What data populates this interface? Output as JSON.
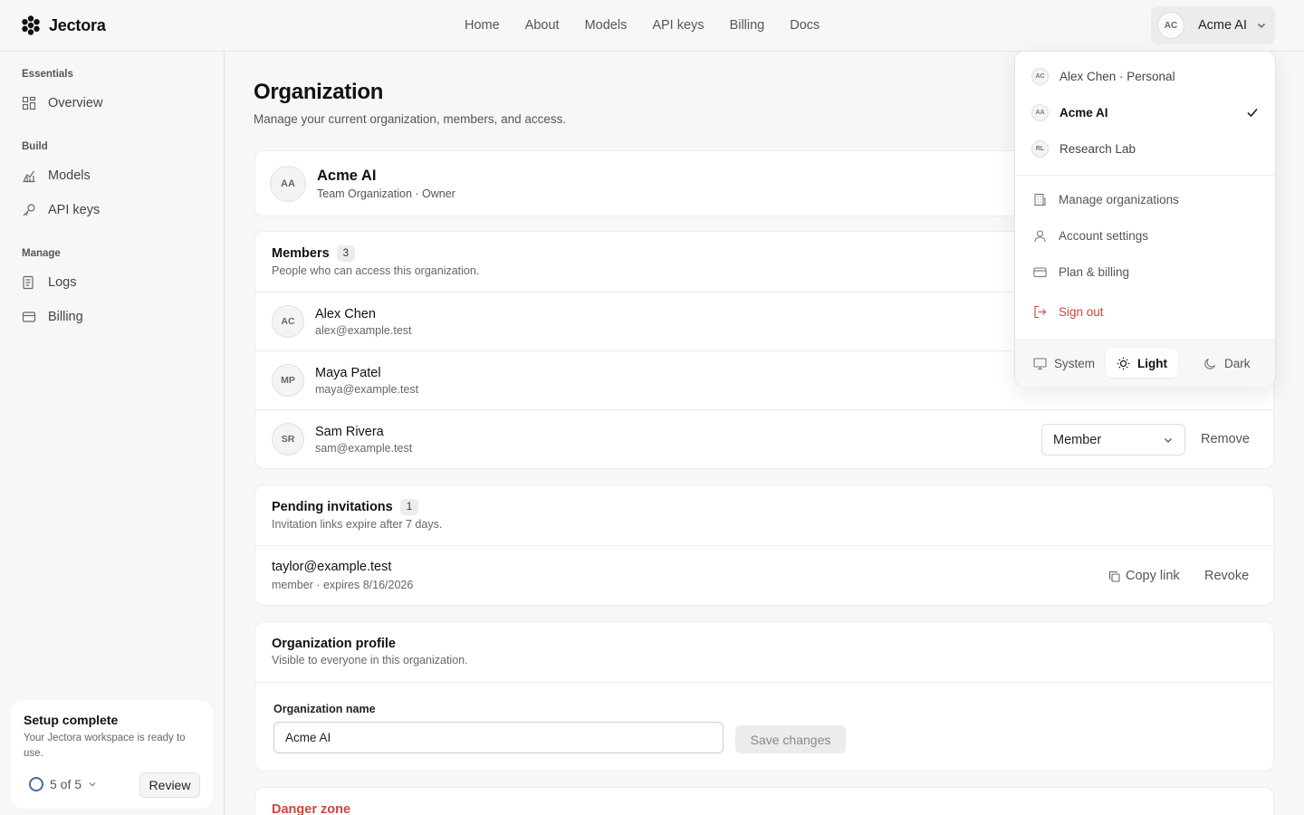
{
  "brand": {
    "name": "Jectora"
  },
  "nav": {
    "items": [
      "Home",
      "About",
      "Models",
      "API keys",
      "Billing",
      "Docs"
    ]
  },
  "account": {
    "initials": "AC",
    "label": "Acme AI"
  },
  "sidebar": {
    "groups": [
      {
        "title": "Essentials",
        "items": [
          "Overview"
        ]
      },
      {
        "title": "Build",
        "items": [
          "Models",
          "API keys"
        ]
      },
      {
        "title": "Manage",
        "items": [
          "Logs",
          "Billing"
        ]
      }
    ],
    "setup": {
      "title": "Setup complete",
      "desc": "Your Jectora workspace is ready to use.",
      "progress": "5 of 5",
      "review": "Review"
    }
  },
  "page": {
    "title": "Organization",
    "subtitle": "Manage your current organization, members, and access."
  },
  "org": {
    "initials": "AA",
    "name": "Acme AI",
    "meta": "Team Organization · Owner"
  },
  "members": {
    "title": "Members",
    "count": "3",
    "subtitle": "People who can access this organization.",
    "rows": [
      {
        "initials": "AC",
        "name": "Alex Chen",
        "email": "alex@example.test"
      },
      {
        "initials": "MP",
        "name": "Maya Patel",
        "email": "maya@example.test"
      },
      {
        "initials": "SR",
        "name": "Sam Rivera",
        "email": "sam@example.test",
        "role": "Member",
        "action": "Remove"
      }
    ]
  },
  "invites": {
    "title": "Pending invitations",
    "count": "1",
    "subtitle": "Invitation links expire after 7 days.",
    "rows": [
      {
        "email": "taylor@example.test",
        "meta": "member · expires 8/16/2026",
        "copy": "Copy link",
        "revoke": "Revoke"
      }
    ]
  },
  "profile": {
    "title": "Organization profile",
    "subtitle": "Visible to everyone in this organization.",
    "field_label": "Organization name",
    "field_value": "Acme AI",
    "save": "Save changes"
  },
  "danger": {
    "title": "Danger zone"
  },
  "dropdown": {
    "orgs": [
      {
        "initials": "AC",
        "label": "Alex Chen · Personal"
      },
      {
        "initials": "AA",
        "label": "Acme AI",
        "selected": true
      },
      {
        "initials": "RL",
        "label": "Research Lab"
      }
    ],
    "items": [
      "Manage organizations",
      "Account settings",
      "Plan & billing"
    ],
    "signout": "Sign out",
    "themes": [
      "System",
      "Light",
      "Dark"
    ],
    "active_theme": "Light"
  },
  "colors": {
    "danger": "#d0453a",
    "accent": "#3b6fa8"
  }
}
